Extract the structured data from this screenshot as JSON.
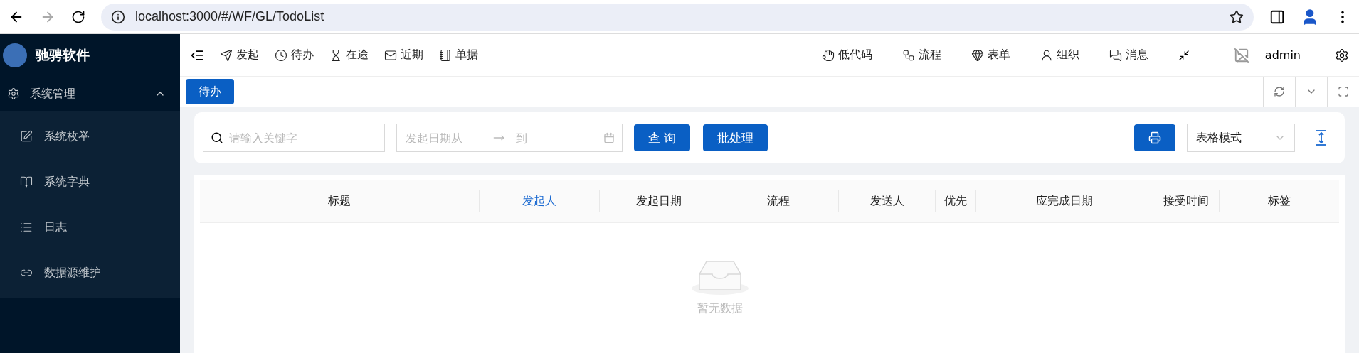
{
  "browser": {
    "url": "localhost:3000/#/WF/GL/TodoList",
    "forward_disabled": true
  },
  "sidebar": {
    "brand": "驰骋软件",
    "groups": [
      {
        "label": "系统管理",
        "expanded": true,
        "children": [
          {
            "label": "系统枚举"
          },
          {
            "label": "系统字典"
          },
          {
            "label": "日志"
          },
          {
            "label": "数据源维护"
          }
        ]
      }
    ]
  },
  "topnav": {
    "left": [
      {
        "label": "发起"
      },
      {
        "label": "待办"
      },
      {
        "label": "在途"
      },
      {
        "label": "近期"
      },
      {
        "label": "单据"
      }
    ],
    "right": [
      {
        "label": "低代码"
      },
      {
        "label": "流程"
      },
      {
        "label": "表单"
      },
      {
        "label": "组织"
      },
      {
        "label": "消息"
      }
    ],
    "user": "admin"
  },
  "tabs": [
    {
      "label": "待办",
      "selected": true
    }
  ],
  "toolbar": {
    "search": {
      "placeholder": "请输入关键字"
    },
    "date_from": {
      "placeholder": "发起日期从"
    },
    "date_to": {
      "placeholder": "到"
    },
    "buttons": [
      "查 询",
      "批处理"
    ],
    "view_mode": "表格模式"
  },
  "table": {
    "columns": [
      {
        "label": "标题",
        "active": false
      },
      {
        "label": "发起人",
        "active": true
      },
      {
        "label": "发起日期",
        "active": false
      },
      {
        "label": "流程",
        "active": false
      },
      {
        "label": "发送人",
        "active": false
      },
      {
        "label": "优先",
        "active": false
      },
      {
        "label": "应完成日期",
        "active": false
      },
      {
        "label": "接受时间",
        "active": false
      },
      {
        "label": "标签",
        "active": false
      }
    ],
    "empty_text": "暂无数据"
  }
}
